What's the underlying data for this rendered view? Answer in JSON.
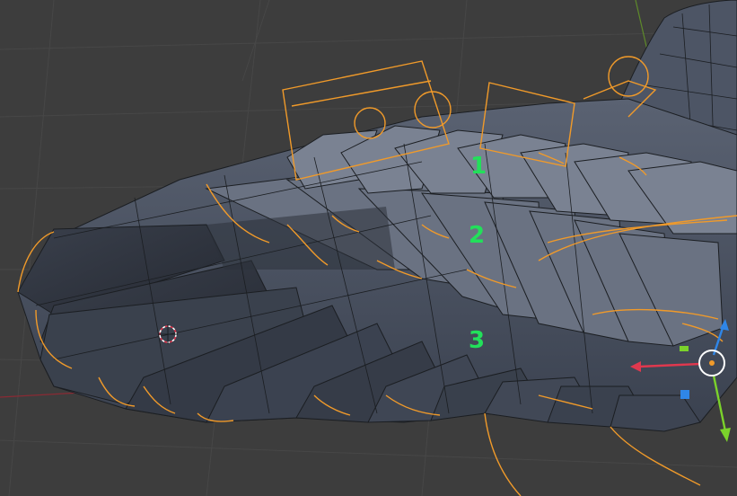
{
  "viewport": {
    "background": "#3d3d3d",
    "grid_color": "#474747",
    "mesh_color": "#4a5260",
    "mesh_dark": "#2a2f38",
    "wire_color": "#1b1e22",
    "bone_color": "#f09a2a",
    "label_color": "#22e05a"
  },
  "labels": {
    "row1": "1",
    "row2": "2",
    "row3": "3"
  },
  "overlay": {
    "cursor_icon": "3d-cursor-icon",
    "gizmo_icon": "transform-gizmo-icon",
    "axis_x_color": "#e0384e",
    "axis_y_color": "#7bd22b",
    "axis_z_color": "#2f86e8"
  }
}
